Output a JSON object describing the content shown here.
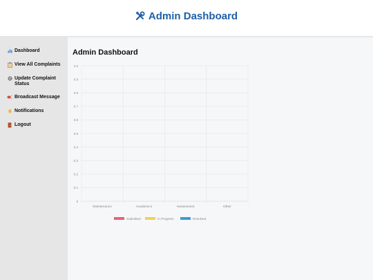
{
  "header": {
    "title": "Admin Dashboard",
    "icon": "tools-icon"
  },
  "sidebar": {
    "items": [
      {
        "label": "Dashboard",
        "icon": "chart-icon"
      },
      {
        "label": "View All Complaints",
        "icon": "clipboard-icon"
      },
      {
        "label": "Update Complaint Status",
        "icon": "gear-icon"
      },
      {
        "label": "Broadcast Message",
        "icon": "megaphone-icon"
      },
      {
        "label": "Notifications",
        "icon": "bell-icon"
      },
      {
        "label": "Logout",
        "icon": "door-icon"
      }
    ]
  },
  "main": {
    "title": "Admin Dashboard"
  },
  "chart_data": {
    "type": "bar",
    "categories": [
      "Maintenance",
      "Academics",
      "Harassment",
      "Other"
    ],
    "series": [
      {
        "name": "Submitted",
        "values": [
          0,
          0,
          0,
          0
        ],
        "color": "#e8627a"
      },
      {
        "name": "In Progress",
        "values": [
          0,
          0,
          0,
          0
        ],
        "color": "#f2cf5b"
      },
      {
        "name": "Resolved",
        "values": [
          0,
          0,
          0,
          0
        ],
        "color": "#3d9ad9"
      }
    ],
    "ylim": [
      0,
      1
    ],
    "yticks": [
      "0",
      "0.1",
      "0.2",
      "0.3",
      "0.4",
      "0.5",
      "0.6",
      "0.7",
      "0.8",
      "0.9",
      "1.0"
    ],
    "grid": true,
    "legend": "bottom"
  }
}
